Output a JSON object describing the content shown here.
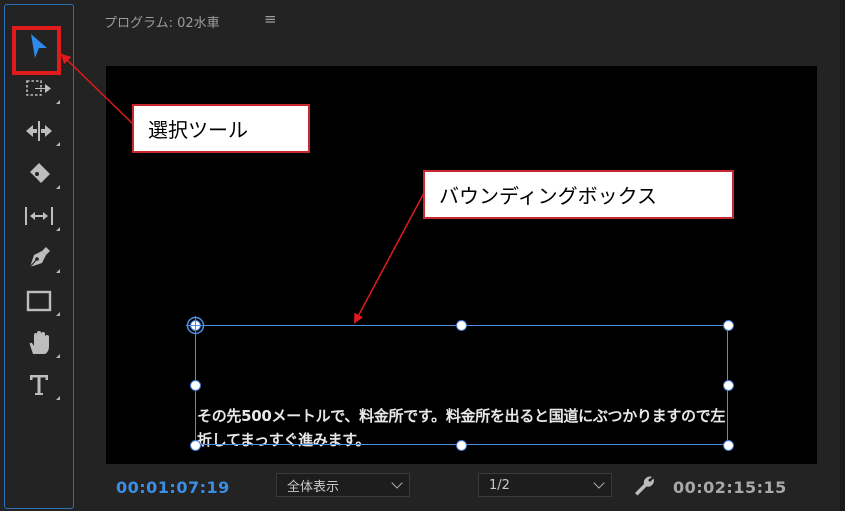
{
  "panel": {
    "title": "プログラム: 02水車",
    "menu_icon": "hamburger-menu-icon"
  },
  "monitor": {
    "caption": "その先500メートルで、料金所です。料金所を出ると国道にぶつかりますので左折してまっすぐ進みます。"
  },
  "playback": {
    "current_timecode": "00:01:07:19",
    "duration_timecode": "00:02:15:15",
    "zoom_select": "全体表示",
    "resolution_select": "1/2"
  },
  "toolbar": {
    "tools": [
      "selection-tool-icon",
      "track-select-tool-icon",
      "ripple-edit-tool-icon",
      "razor-tool-icon",
      "slip-tool-icon",
      "pen-tool-icon",
      "rectangle-tool-icon",
      "hand-tool-icon",
      "type-tool-icon"
    ]
  },
  "annotations": {
    "select_tool_label": "選択ツール",
    "bounding_box_label": "バウンディングボックス"
  },
  "colors": {
    "accent": "#2d8ceb",
    "annotation_red": "#e01b1b",
    "bbox_blue": "#4f8ee8"
  }
}
